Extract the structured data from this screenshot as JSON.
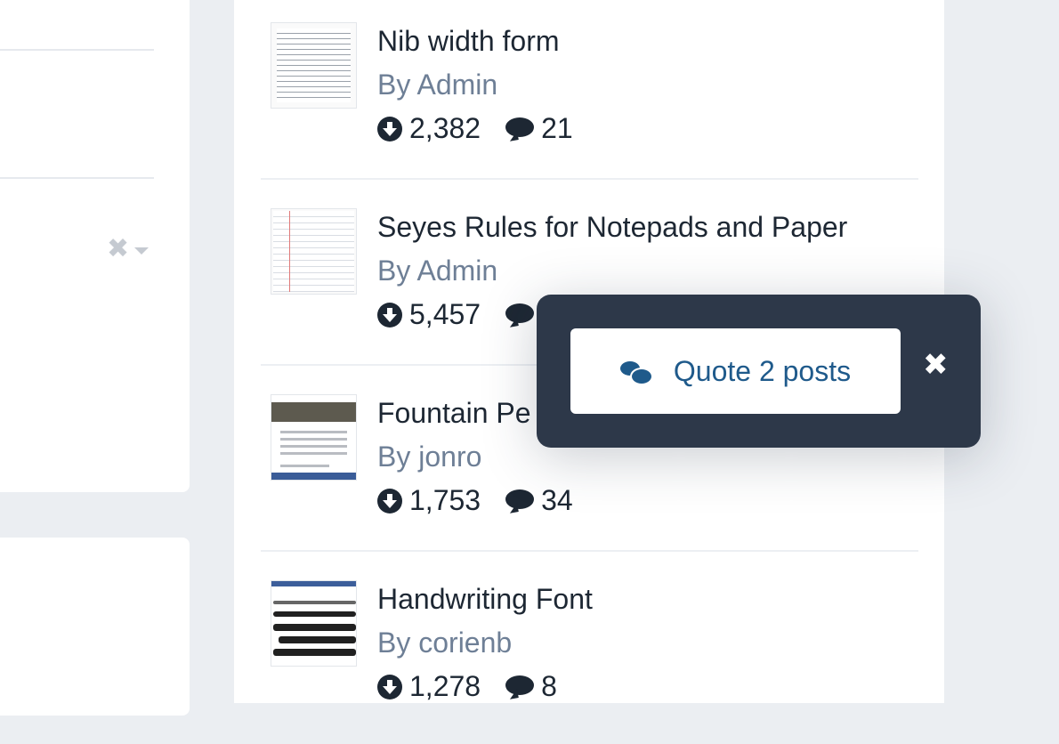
{
  "items": [
    {
      "title": "Nib width form",
      "author": "By Admin",
      "downloads": "2,382",
      "comments": "21"
    },
    {
      "title": "Seyes Rules for Notepads and Paper",
      "author": "By Admin",
      "downloads": "5,457",
      "comments": ""
    },
    {
      "title": "Fountain Pe",
      "author": "By jonro",
      "downloads": "1,753",
      "comments": "34"
    },
    {
      "title": "Handwriting Font",
      "author": "By corienb",
      "downloads": "1,278",
      "comments": "8"
    }
  ],
  "quote_popup": {
    "button_label": "Quote 2 posts",
    "close_symbol": "✖"
  },
  "icons": {
    "download": "download-circle-icon",
    "comments": "comment-bubble-icon",
    "quote": "comments-icon",
    "close": "close-icon",
    "filter_clear": "clear-x-icon"
  },
  "colors": {
    "popup_bg": "#2d3849",
    "accent": "#1f5a8b",
    "author": "#6e7f96",
    "title": "#1d2733"
  }
}
